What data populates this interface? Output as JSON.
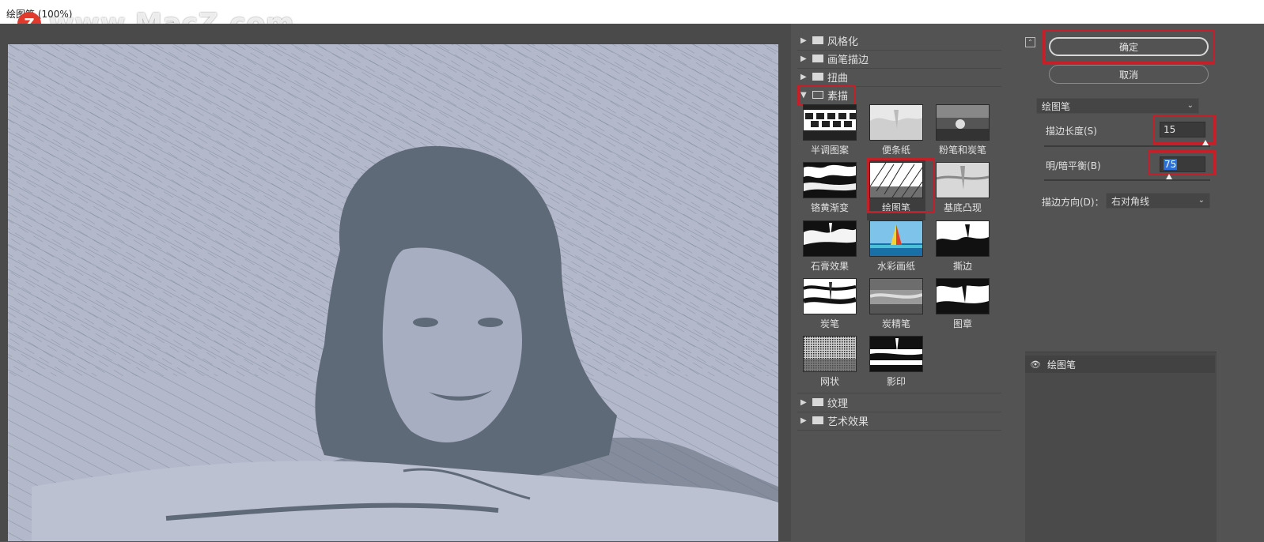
{
  "window": {
    "title": "绘图笔 (100%)"
  },
  "watermark": {
    "logo_letter": "Z",
    "text": "www.MacZ.com"
  },
  "filter_gallery": {
    "categories_top": [
      {
        "label": "风格化",
        "expanded": false
      },
      {
        "label": "画笔描边",
        "expanded": false
      },
      {
        "label": "扭曲",
        "expanded": false
      },
      {
        "label": "素描",
        "expanded": true
      }
    ],
    "sketch_filters": [
      {
        "label": "半调图案",
        "selected": false
      },
      {
        "label": "便条纸",
        "selected": false
      },
      {
        "label": "粉笔和炭笔",
        "selected": false
      },
      {
        "label": "铬黄渐变",
        "selected": false
      },
      {
        "label": "绘图笔",
        "selected": true
      },
      {
        "label": "基底凸现",
        "selected": false
      },
      {
        "label": "石膏效果",
        "selected": false
      },
      {
        "label": "水彩画纸",
        "selected": false
      },
      {
        "label": "撕边",
        "selected": false
      },
      {
        "label": "炭笔",
        "selected": false
      },
      {
        "label": "炭精笔",
        "selected": false
      },
      {
        "label": "图章",
        "selected": false
      },
      {
        "label": "网状",
        "selected": false
      },
      {
        "label": "影印",
        "selected": false
      }
    ],
    "categories_bottom": [
      {
        "label": "纹理",
        "expanded": false
      },
      {
        "label": "艺术效果",
        "expanded": false
      }
    ]
  },
  "settings": {
    "ok_label": "确定",
    "cancel_label": "取消",
    "filter_select": "绘图笔",
    "stroke_length": {
      "label": "描边长度(S)",
      "value": "15",
      "slider_fraction": 0.97
    },
    "light_dark_balance": {
      "label": "明/暗平衡(B)",
      "value": "75",
      "slider_fraction": 0.75
    },
    "stroke_direction": {
      "label": "描边方向(D)：",
      "value": "右对角线"
    }
  },
  "layers": {
    "items": [
      {
        "name": "绘图笔",
        "visible": true
      }
    ]
  },
  "colors": {
    "highlight_red": "#c4202a",
    "panel_bg": "#535353",
    "preview_light": "#a9b0c3",
    "preview_dark": "#5f6a78"
  }
}
